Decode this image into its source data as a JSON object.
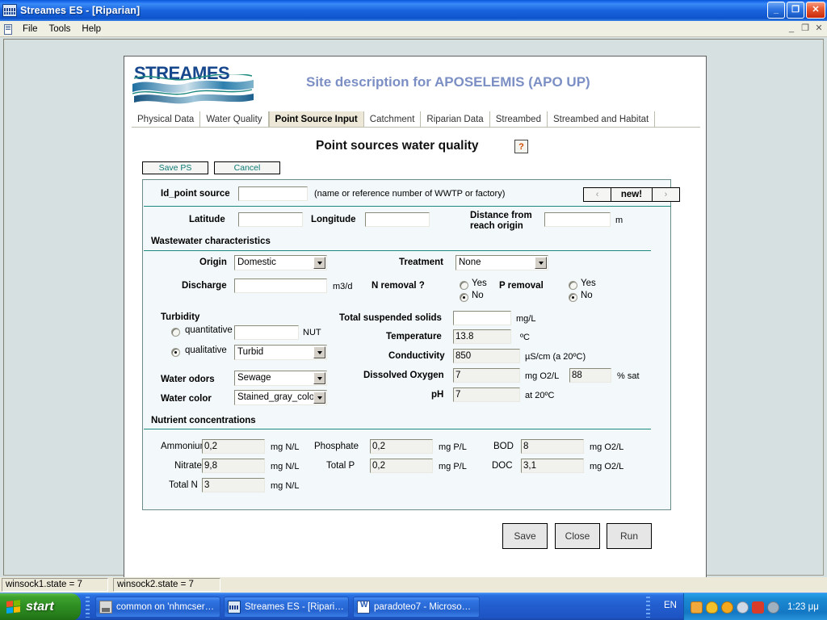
{
  "window": {
    "title": "Streames ES - [Riparian]",
    "minimize": "_",
    "restore": "❐",
    "close": "✕",
    "mdi_minimize": "_",
    "mdi_restore": "❐",
    "mdi_close": "✕"
  },
  "menu": {
    "items": [
      "File",
      "Tools",
      "Help"
    ]
  },
  "header": {
    "logo_text": "STREAMES",
    "page_title": "Site description for APOSELEMIS (APO UP)"
  },
  "tabs": [
    {
      "label": "Physical Data",
      "active": false
    },
    {
      "label": "Water Quality",
      "active": false
    },
    {
      "label": "Point Source Input",
      "active": true
    },
    {
      "label": "Catchment",
      "active": false
    },
    {
      "label": "Riparian Data",
      "active": false
    },
    {
      "label": "Streambed",
      "active": false
    },
    {
      "label": "Streambed and Habitat",
      "active": false
    }
  ],
  "form": {
    "title": "Point sources water quality",
    "help_label": "?",
    "save_ps_label": "Save PS",
    "cancel_label": "Cancel",
    "id_point_source": {
      "label": "Id_point source",
      "value": "",
      "hint": "(name or reference number of WWTP or factory)"
    },
    "nav": {
      "prev": "‹",
      "new": "new!",
      "next": "›"
    },
    "latitude": {
      "label": "Latitude",
      "value": ""
    },
    "longitude": {
      "label": "Longitude",
      "value": ""
    },
    "distance": {
      "label_line1": "Distance from",
      "label_line2": "reach origin",
      "value": "",
      "unit": "m"
    },
    "wastewater_heading": "Wastewater characteristics",
    "origin": {
      "label": "Origin",
      "value": "Domestic"
    },
    "treatment": {
      "label": "Treatment",
      "value": "None"
    },
    "discharge": {
      "label": "Discharge",
      "value": "",
      "unit": "m3/d"
    },
    "n_removal": {
      "label": "N removal ?",
      "yes": "Yes",
      "no": "No",
      "selected": "No"
    },
    "p_removal": {
      "label": "P removal",
      "yes": "Yes",
      "no": "No",
      "selected": "No"
    },
    "turbidity": {
      "heading": "Turbidity",
      "quantitative_label": "quantitative",
      "quantitative_value": "",
      "quantitative_unit": "NUT",
      "qualitative_label": "qualitative",
      "qualitative_value": "Turbid",
      "selected": "qualitative"
    },
    "water_odors": {
      "label": "Water odors",
      "value": "Sewage"
    },
    "water_color": {
      "label": "Water color",
      "value": "Stained_gray_colo"
    },
    "tss": {
      "label": "Total suspended solids",
      "value": "",
      "unit": "mg/L"
    },
    "temperature": {
      "label": "Temperature",
      "value": "13.8",
      "unit": "ºC"
    },
    "conductivity": {
      "label": "Conductivity",
      "value": "850",
      "unit": "µS/cm (a 20ºC)"
    },
    "dissolved_oxygen": {
      "label": "Dissolved Oxygen",
      "value": "7",
      "unit": "mg O2/L",
      "sat_value": "88",
      "sat_unit": "% sat"
    },
    "ph": {
      "label": "pH",
      "value": "7",
      "unit": "at 20ºC"
    },
    "nutrient_heading": "Nutrient concentrations",
    "ammonium": {
      "label": "Ammonium",
      "value": "0,2",
      "unit": "mg N/L"
    },
    "nitrate": {
      "label": "Nitrate",
      "value": "9,8",
      "unit": "mg N/L"
    },
    "total_n": {
      "label": "Total N",
      "value": "3",
      "unit": "mg N/L"
    },
    "phosphate": {
      "label": "Phosphate",
      "value": "0,2",
      "unit": "mg P/L"
    },
    "total_p": {
      "label": "Total P",
      "value": "0,2",
      "unit": "mg P/L"
    },
    "bod": {
      "label": "BOD",
      "value": "8",
      "unit": "mg O2/L"
    },
    "doc": {
      "label": "DOC",
      "value": "3,1",
      "unit": "mg O2/L"
    },
    "bottom_buttons": {
      "save": "Save",
      "close": "Close",
      "run": "Run"
    }
  },
  "statusbar": {
    "cell1": "winsock1.state =   7",
    "cell2": "winsock2.state =   7"
  },
  "taskbar": {
    "start_label": "start",
    "items": [
      {
        "label": "common on 'nhmcser…"
      },
      {
        "label": "Streames ES - [Ripari…"
      },
      {
        "label": "paradoteo7 - Microso…"
      }
    ],
    "language": "EN",
    "clock": "1:23 μμ"
  },
  "colors": {
    "accent_teal": "#1d8a80",
    "title_blue": "#7b8fc4",
    "logo_blue": "#16468c",
    "desktop": "#d6e0e0"
  }
}
